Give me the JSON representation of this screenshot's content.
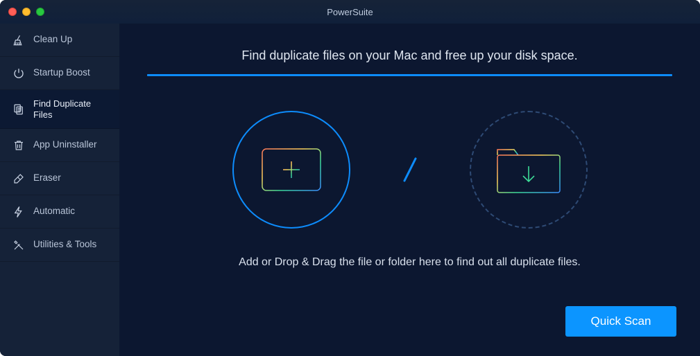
{
  "window": {
    "title": "PowerSuite"
  },
  "sidebar": {
    "items": [
      {
        "label": "Clean Up"
      },
      {
        "label": "Startup Boost"
      },
      {
        "label": "Find Duplicate Files"
      },
      {
        "label": "App Uninstaller"
      },
      {
        "label": "Eraser"
      },
      {
        "label": "Automatic"
      },
      {
        "label": "Utilities & Tools"
      }
    ]
  },
  "main": {
    "heading": "Find duplicate files on your Mac and free up your disk space.",
    "instruction": "Add or Drop & Drag the file or folder here to find out all duplicate files.",
    "scan_button": "Quick Scan"
  },
  "colors": {
    "accent": "#0d8cfc",
    "button": "#0c95ff",
    "bg_main": "#0c1730",
    "bg_sidebar": "#152238"
  }
}
